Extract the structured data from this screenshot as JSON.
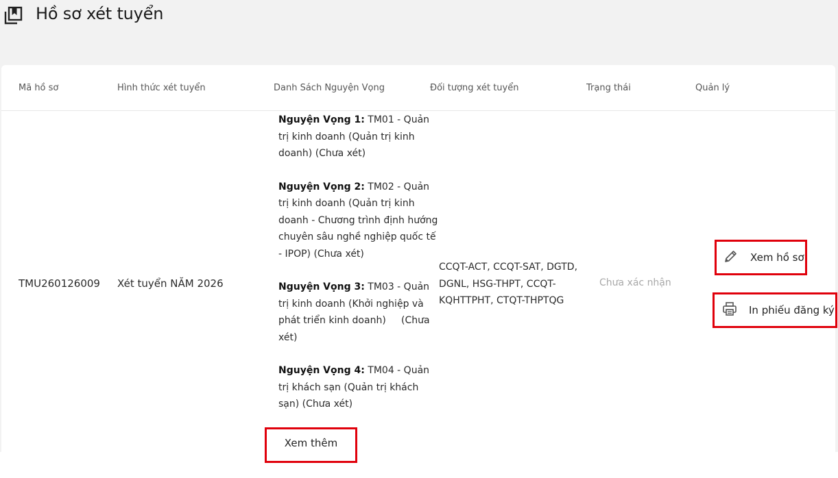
{
  "page": {
    "title": "Hồ sơ xét tuyển"
  },
  "table": {
    "headers": {
      "ma_ho_so": "Mã hồ sơ",
      "hinh_thuc": "Hình thức xét tuyển",
      "danh_sach": "Danh Sách Nguyện Vọng",
      "doi_tuong": "Đối tượng xét tuyển",
      "trang_thai": "Trạng thái",
      "quan_ly": "Quản lý"
    },
    "row": {
      "ma_ho_so": "TMU260126009",
      "hinh_thuc": "Xét tuyển NĂM 2026",
      "wishes": [
        {
          "label": "Nguyện Vọng 1:",
          "text": " TM01 - Quản trị kinh doanh (Quản trị kinh doanh) (Chưa xét)"
        },
        {
          "label": "Nguyện Vọng 2:",
          "text": " TM02 - Quản trị kinh doanh (Quản trị kinh doanh - Chương trình định hướng chuyên sâu nghề nghiệp quốc tế - IPOP) (Chưa xét)"
        },
        {
          "label": "Nguyện Vọng 3:",
          "text": " TM03 - Quản trị kinh doanh (Khởi nghiệp và phát triển kinh doanh)     (Chưa xét)"
        },
        {
          "label": "Nguyện Vọng 4:",
          "text": " TM04 - Quản trị khách sạn (Quản trị khách sạn) (Chưa xét)"
        }
      ],
      "doi_tuong": "CCQT-ACT, CCQT-SAT, DGTD, DGNL, HSG-THPT, CCQT-KQHTTPHT, CTQT-THPTQG",
      "trang_thai": "Chưa xác nhận"
    },
    "actions": {
      "view_label": "Xem hồ sơ",
      "view_icon": "pencil-icon",
      "print_label": "In phiếu đăng ký",
      "print_icon": "printer-icon"
    },
    "see_more_label": "Xem thêm"
  },
  "colors": {
    "highlight": "#e0000b",
    "status_muted": "#a8a8a8",
    "background": "#f2f2f2"
  }
}
